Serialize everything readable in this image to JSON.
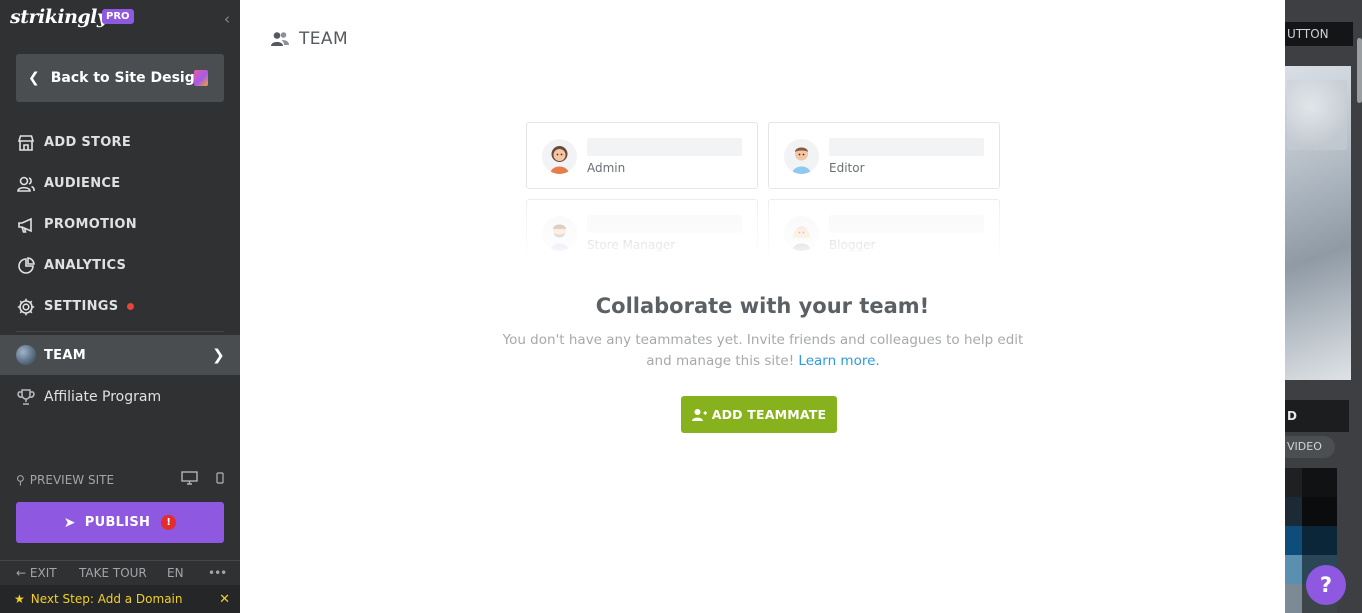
{
  "sidebar": {
    "logo": "strikingly",
    "pro_badge": "PRO",
    "back_button": "Back to Site Design",
    "items": [
      {
        "label": "ADD STORE",
        "icon": "store-icon"
      },
      {
        "label": "AUDIENCE",
        "icon": "audience-icon"
      },
      {
        "label": "PROMOTION",
        "icon": "megaphone-icon"
      },
      {
        "label": "ANALYTICS",
        "icon": "pie-chart-icon"
      },
      {
        "label": "SETTINGS",
        "icon": "gear-icon"
      },
      {
        "label": "TEAM",
        "icon": "team-globe-icon"
      },
      {
        "label": "Affiliate Program",
        "icon": "trophy-icon"
      }
    ],
    "preview_label": "PREVIEW SITE",
    "publish_label": "PUBLISH",
    "publish_alert": "!",
    "bottom": {
      "exit": "EXIT",
      "take_tour": "TAKE TOUR",
      "lang": "EN",
      "more": "•••"
    },
    "next_step": "Next Step: Add a Domain"
  },
  "main": {
    "title": "TEAM",
    "roles": [
      "Admin",
      "Editor",
      "Store Manager",
      "Blogger"
    ],
    "headline": "Collaborate with your team!",
    "description": "You don't have any teammates yet. Invite friends and colleagues to help edit and manage this site!",
    "learn_more": "Learn more.",
    "add_button": "ADD TEAMMATE"
  },
  "background": {
    "button_fragment": "UTTON",
    "label_fragment": "D",
    "video_fragment": "VIDEO"
  },
  "help_label": "?",
  "colors": {
    "sidebar_bg": "#2f3133",
    "accent_purple": "#8e58e0",
    "add_button_green": "#87b21d",
    "link_blue": "#2d9cdb",
    "next_step_yellow": "#f2d027",
    "settings_dot_red": "#e5453b"
  }
}
